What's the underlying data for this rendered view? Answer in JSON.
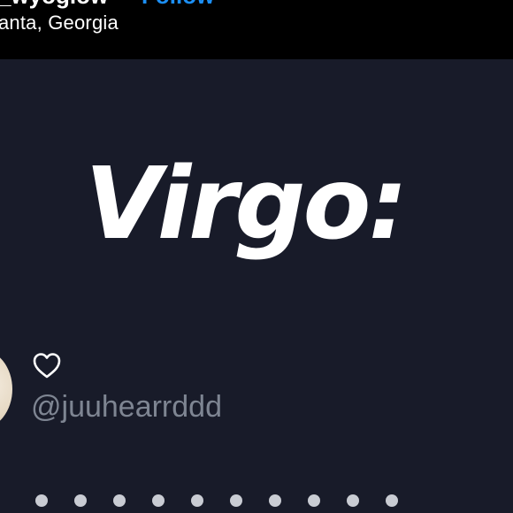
{
  "header": {
    "username": "_wyoglow",
    "follow_label": "Follow",
    "location": "anta, Georgia"
  },
  "post": {
    "headline": "Virgo:",
    "tweet": {
      "handle": "@juuhearrddd",
      "like_icon": "heart-icon",
      "avatar": "avatar"
    }
  },
  "colors": {
    "topbar_background": "#000000",
    "post_background": "#181b29",
    "follow_accent": "#1c8ff5",
    "handle_gray": "#7e8592",
    "text_white": "#ffffff"
  }
}
